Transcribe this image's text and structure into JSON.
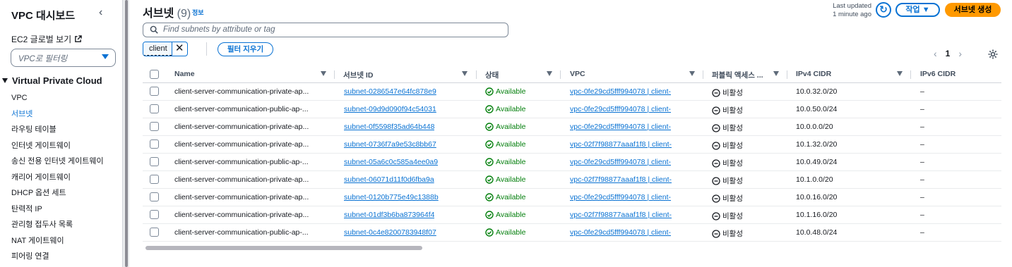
{
  "sidebar": {
    "title": "VPC 대시보드",
    "global_view": "EC2 글로벌 보기",
    "filter_placeholder": "VPC로 필터링",
    "section": "Virtual Private Cloud",
    "items": [
      {
        "label": "VPC"
      },
      {
        "label": "서브넷",
        "active": true
      },
      {
        "label": "라우팅 테이블"
      },
      {
        "label": "인터넷 게이트웨이"
      },
      {
        "label": "송신 전용 인터넷 게이트웨이"
      },
      {
        "label": "캐리어 게이트웨이"
      },
      {
        "label": "DHCP 옵션 세트"
      },
      {
        "label": "탄력적 IP"
      },
      {
        "label": "관리형 접두사 목록"
      },
      {
        "label": "NAT 게이트웨이"
      },
      {
        "label": "피어링 연결"
      }
    ]
  },
  "header": {
    "title": "서브넷",
    "count": "(9)",
    "info": "정보",
    "last_updated_line1": "Last updated",
    "last_updated_line2": "1 minute ago",
    "actions_label": "작업 ▼",
    "create_label": "서브넷 생성"
  },
  "search": {
    "placeholder": "Find subnets by attribute or tag",
    "token": "client",
    "clear_label": "필터 지우기"
  },
  "pagination": {
    "current": "1"
  },
  "table": {
    "columns": [
      "Name",
      "서브넷 ID",
      "상태",
      "VPC",
      "퍼블릭 액세스 ...",
      "IPv4 CIDR",
      "IPv6 CIDR"
    ],
    "rows": [
      {
        "name": "client-server-communication-private-ap...",
        "id": "subnet-0286547e64fc878e9",
        "state": "Available",
        "vpc": "vpc-0fe29cd5fff994078 | client-",
        "public": "비활성",
        "ipv4": "10.0.32.0/20",
        "ipv6": "–"
      },
      {
        "name": "client-server-communication-public-ap-...",
        "id": "subnet-09d9d090f94c54031",
        "state": "Available",
        "vpc": "vpc-0fe29cd5fff994078 | client-",
        "public": "비활성",
        "ipv4": "10.0.50.0/24",
        "ipv6": "–"
      },
      {
        "name": "client-server-communication-private-ap...",
        "id": "subnet-0f5598f35ad64b448",
        "state": "Available",
        "vpc": "vpc-0fe29cd5fff994078 | client-",
        "public": "비활성",
        "ipv4": "10.0.0.0/20",
        "ipv6": "–"
      },
      {
        "name": "client-server-communication-private-ap...",
        "id": "subnet-0736f7a9e53c8bb67",
        "state": "Available",
        "vpc": "vpc-02f7f98877aaaf1f8 | client-",
        "public": "비활성",
        "ipv4": "10.1.32.0/20",
        "ipv6": "–"
      },
      {
        "name": "client-server-communication-public-ap-...",
        "id": "subnet-05a6c0c585a4ee0a9",
        "state": "Available",
        "vpc": "vpc-0fe29cd5fff994078 | client-",
        "public": "비활성",
        "ipv4": "10.0.49.0/24",
        "ipv6": "–"
      },
      {
        "name": "client-server-communication-private-ap...",
        "id": "subnet-06071d11f0d6fba9a",
        "state": "Available",
        "vpc": "vpc-02f7f98877aaaf1f8 | client-",
        "public": "비활성",
        "ipv4": "10.1.0.0/20",
        "ipv6": "–"
      },
      {
        "name": "client-server-communication-private-ap...",
        "id": "subnet-0120b775e49c1388b",
        "state": "Available",
        "vpc": "vpc-0fe29cd5fff994078 | client-",
        "public": "비활성",
        "ipv4": "10.0.16.0/20",
        "ipv6": "–"
      },
      {
        "name": "client-server-communication-private-ap...",
        "id": "subnet-01df3b6ba873964f4",
        "state": "Available",
        "vpc": "vpc-02f7f98877aaaf1f8 | client-",
        "public": "비활성",
        "ipv4": "10.1.16.0/20",
        "ipv6": "–"
      },
      {
        "name": "client-server-communication-public-ap-...",
        "id": "subnet-0c4e8200783948f07",
        "state": "Available",
        "vpc": "vpc-0fe29cd5fff994078 | client-",
        "public": "비활성",
        "ipv4": "10.0.48.0/24",
        "ipv6": "–"
      }
    ]
  },
  "colors": {
    "link": "#0972d3",
    "primary": "#ff9900",
    "success": "#037f0c"
  }
}
